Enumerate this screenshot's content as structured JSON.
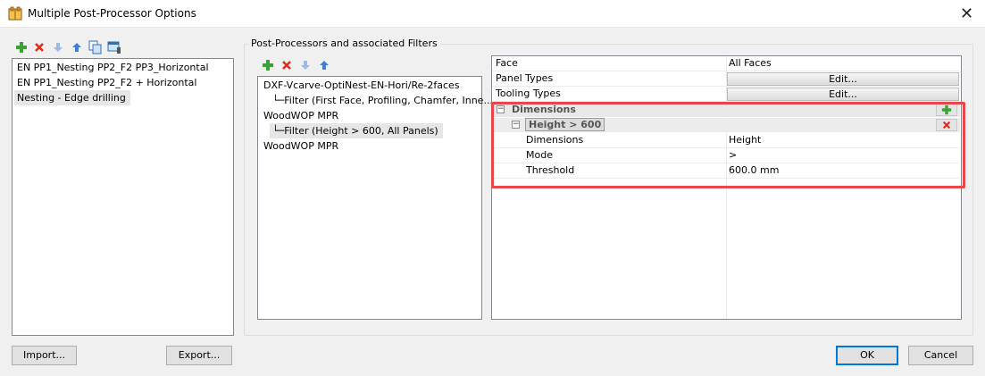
{
  "window": {
    "title": "Multiple Post-Processor Options",
    "close_glyph": "✕"
  },
  "left_list": {
    "items": [
      "EN PP1_Nesting PP2_F2 PP3_Horizontal",
      "EN PP1_Nesting PP2_F2 + Horizontal",
      "Nesting - Edge drilling"
    ],
    "selected_index": 2
  },
  "group": {
    "title": "Post-Processors and associated Filters"
  },
  "tree": {
    "items": [
      {
        "text": "DXF-Vcarve-OptiNest-EN-Hori/Re-2faces",
        "indent": 0
      },
      {
        "text": "└─Filter (First Face, Profiling, Chamfer, Inne...",
        "indent": 1
      },
      {
        "text": "WoodWOP MPR",
        "indent": 0
      },
      {
        "text": "└─Filter (Height > 600, All Panels)",
        "indent": 1
      },
      {
        "text": "WoodWOP MPR",
        "indent": 0
      }
    ],
    "selected_index": 3
  },
  "properties": {
    "rows": [
      {
        "name": "Face",
        "value": "All Faces"
      },
      {
        "name": "Panel Types",
        "button": "Edit..."
      },
      {
        "name": "Tooling Types",
        "button": "Edit..."
      }
    ],
    "dimensions_section": {
      "label": "Dimensions",
      "filter_label": "Height > 600",
      "rows": [
        {
          "name": "Dimensions",
          "value": "Height"
        },
        {
          "name": "Mode",
          "value": ">"
        },
        {
          "name": "Threshold",
          "value": "600.0 mm"
        }
      ]
    }
  },
  "buttons": {
    "import": "Import...",
    "export": "Export...",
    "ok": "OK",
    "cancel": "Cancel"
  },
  "colors": {
    "add": "#3aa335",
    "delete": "#e02a1b",
    "arrow": "#3f7fd6",
    "highlight": "#e8464b",
    "default_button": "#0078d7"
  }
}
